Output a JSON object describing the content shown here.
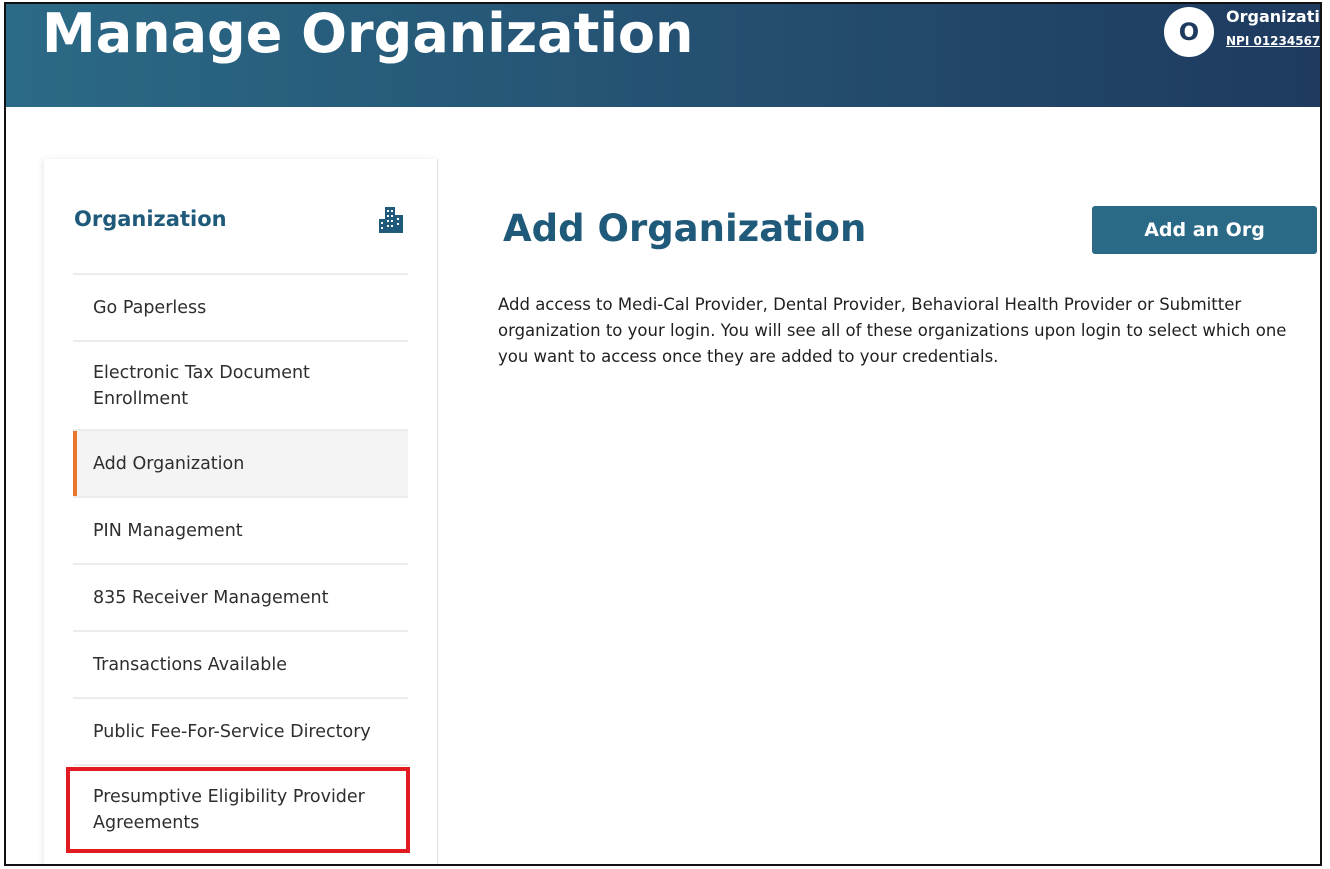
{
  "header": {
    "title": "Manage Organization",
    "org_initial": "O",
    "org_name": "Organizati",
    "org_npi": "NPI 01234567"
  },
  "sidebar": {
    "heading": "Organization",
    "heading_icon": "building-icon",
    "items": [
      {
        "label": "Go Paperless",
        "active": false
      },
      {
        "label": "Electronic Tax Document Enrollment",
        "active": false
      },
      {
        "label": "Add Organization",
        "active": true
      },
      {
        "label": "PIN Management",
        "active": false
      },
      {
        "label": "835 Receiver Management",
        "active": false
      },
      {
        "label": "Transactions Available",
        "active": false
      },
      {
        "label": "Public Fee-For-Service Directory",
        "active": false
      },
      {
        "label": "Presumptive Eligibility Provider Agreements",
        "active": false,
        "highlighted": true
      }
    ]
  },
  "main": {
    "title": "Add Organization",
    "button_label": "Add an Org",
    "description": "Add access to Medi-Cal Provider, Dental Provider, Behavioral Health Provider or Submitter organization to your login. You will see all of these organizations upon login to select which one you want to access once they are added to your credentials."
  },
  "colors": {
    "header_start": "#2b6a86",
    "header_end": "#1e3a5f",
    "accent_active": "#e8762b",
    "highlight_box": "#e21b23",
    "heading_text": "#1f5a7a"
  }
}
